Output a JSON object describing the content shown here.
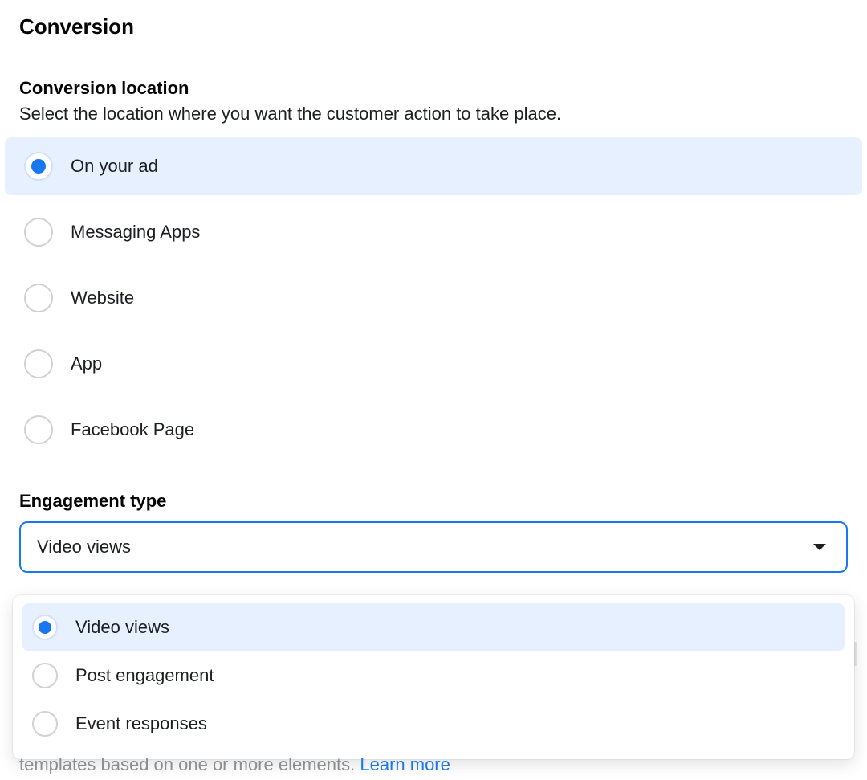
{
  "section_title": "Conversion",
  "conversion_location": {
    "title": "Conversion location",
    "description": "Select the location where you want the customer action to take place.",
    "options": [
      {
        "label": "On your ad",
        "selected": true
      },
      {
        "label": "Messaging Apps",
        "selected": false
      },
      {
        "label": "Website",
        "selected": false
      },
      {
        "label": "App",
        "selected": false
      },
      {
        "label": "Facebook Page",
        "selected": false
      }
    ]
  },
  "engagement_type": {
    "title": "Engagement type",
    "selected_value": "Video views",
    "options": [
      {
        "label": "Video views",
        "selected": true
      },
      {
        "label": "Post engagement",
        "selected": false
      },
      {
        "label": "Event responses",
        "selected": false
      }
    ]
  },
  "truncated": {
    "text_prefix": "templates based on one or more elements. ",
    "link_text": "Learn more"
  }
}
